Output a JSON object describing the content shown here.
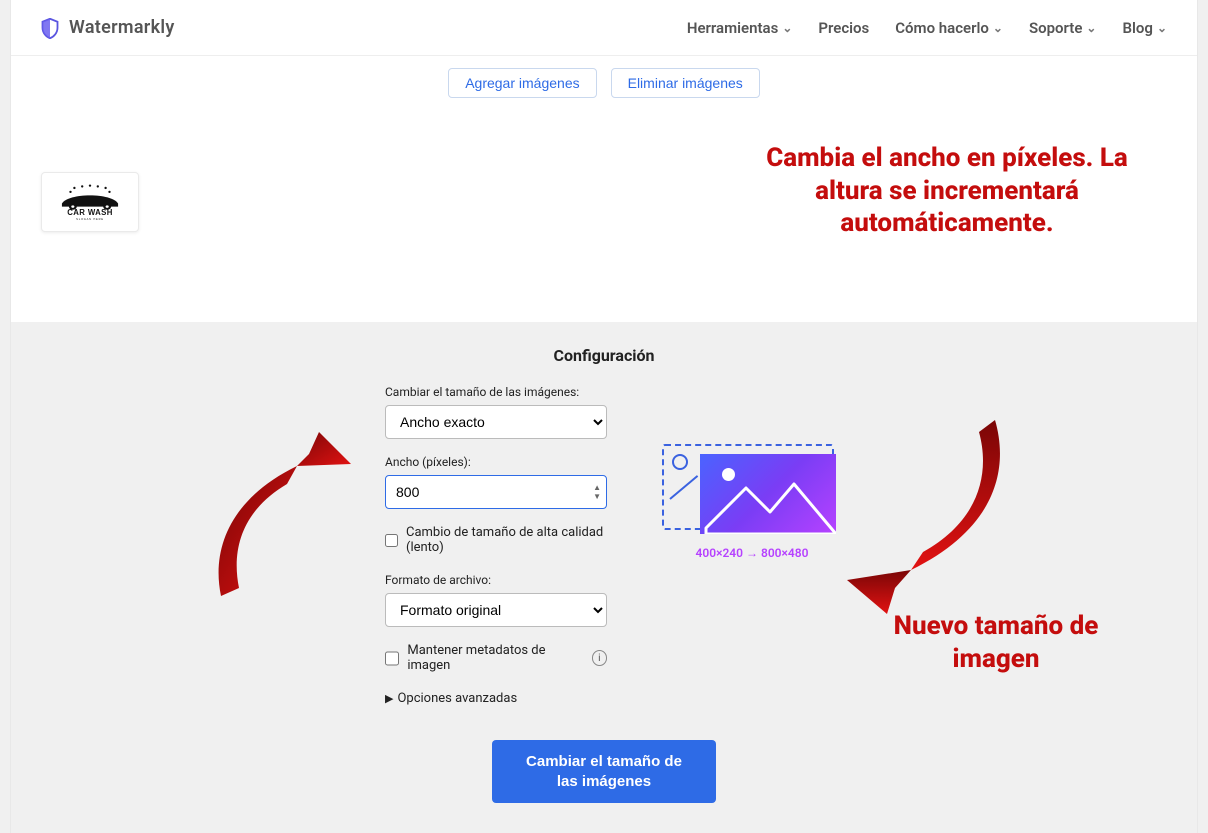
{
  "header": {
    "brand": "Watermarkly",
    "nav": {
      "herramientas": "Herramientas",
      "precios": "Precios",
      "como_hacerlo": "Cómo hacerlo",
      "soporte": "Soporte",
      "blog": "Blog"
    }
  },
  "actions": {
    "agregar": "Agregar imágenes",
    "eliminar": "Eliminar imágenes"
  },
  "thumbnail": {
    "caption_main": "CAR WASH",
    "caption_sub": "SLOGAN HERE"
  },
  "annotation_top": "Cambia el ancho en píxeles. La altura se incrementará automáticamente.",
  "annotation_bottom": "Nuevo tamaño de imagen",
  "config": {
    "title": "Configuración",
    "resize_label": "Cambiar el tamaño de las imágenes:",
    "resize_value": "Ancho exacto",
    "width_label": "Ancho (píxeles):",
    "width_value": "800",
    "hq_label": "Cambio de tamaño de alta calidad (lento)",
    "format_label": "Formato de archivo:",
    "format_value": "Formato original",
    "keep_meta_label": "Mantener metadatos de imagen",
    "advanced_label": "Opciones avanzadas",
    "submit": "Cambiar el tamaño de las imágenes"
  },
  "preview": {
    "dimensions": "400×240 → 800×480"
  }
}
